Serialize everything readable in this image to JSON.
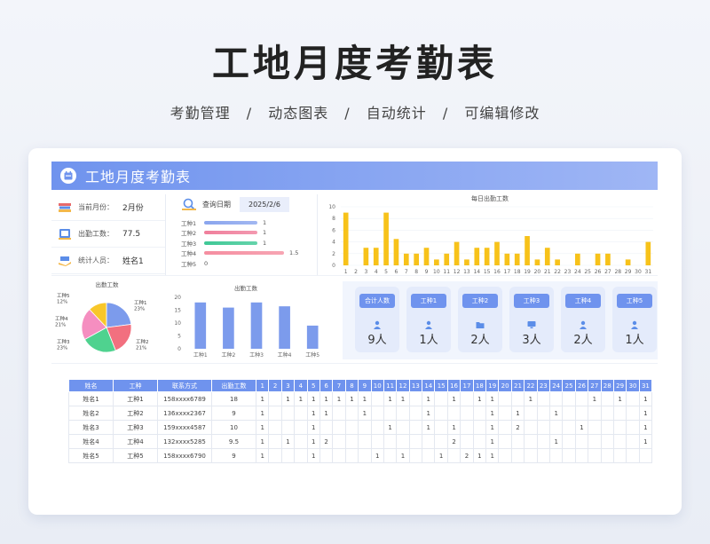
{
  "hero": {
    "title": "工地月度考勤表",
    "features": [
      "考勤管理",
      "动态图表",
      "自动统计",
      "可编辑修改"
    ],
    "separators": [
      "/",
      "/",
      "/"
    ]
  },
  "banner": {
    "title": "工地月度考勤表",
    "icon": "calendar-icon"
  },
  "info": [
    {
      "label": "当前月份：",
      "value": "2月份",
      "icon": "books-icon"
    },
    {
      "label": "出勤工数：",
      "value": "77.5",
      "icon": "board-icon"
    },
    {
      "label": "统计人员：",
      "value": "姓名1",
      "icon": "hand-book-icon"
    }
  ],
  "query": {
    "label": "查询日期",
    "date": "2025/2/6",
    "icon": "magnifier-icon",
    "rows": [
      {
        "name": "工种1",
        "value": 1,
        "label": "1",
        "color": "#8aa5ee"
      },
      {
        "name": "工种2",
        "value": 1,
        "label": "1",
        "color": "#f07f9c"
      },
      {
        "name": "工种3",
        "value": 1,
        "label": "1",
        "color": "#3fc896"
      },
      {
        "name": "工种4",
        "value": 1.5,
        "label": "1.5",
        "color": "#f58ea0"
      },
      {
        "name": "工种5",
        "value": 0,
        "label": "0",
        "color": "#8aa5ee"
      }
    ]
  },
  "chart_data": [
    {
      "type": "bar",
      "title": "每日出勤工数",
      "categories": [
        "1",
        "2",
        "3",
        "4",
        "5",
        "6",
        "7",
        "8",
        "9",
        "10",
        "11",
        "12",
        "13",
        "14",
        "15",
        "16",
        "17",
        "18",
        "19",
        "20",
        "21",
        "22",
        "23",
        "24",
        "25",
        "26",
        "27",
        "28",
        "29",
        "30",
        "31"
      ],
      "values": [
        9,
        0,
        3,
        3,
        9,
        4.5,
        2,
        2,
        3,
        1,
        2,
        4,
        1,
        3,
        3,
        4,
        2,
        2,
        5,
        1,
        3,
        1,
        0,
        2,
        0,
        2,
        2,
        0,
        1,
        0,
        4
      ],
      "ylim": [
        0,
        10
      ],
      "yticks": [
        0,
        2,
        4,
        6,
        8,
        10
      ],
      "color": "#f7c21a"
    },
    {
      "type": "pie",
      "title": "出勤工数",
      "slices": [
        {
          "name": "工种1",
          "pct": "23%",
          "value": 23,
          "color": "#7c9bec"
        },
        {
          "name": "工种2",
          "pct": "21%",
          "value": 21,
          "color": "#f2707f"
        },
        {
          "name": "工种3",
          "pct": "23%",
          "value": 23,
          "color": "#4fd28f"
        },
        {
          "name": "工种4",
          "pct": "21%",
          "value": 21,
          "color": "#f58ec0"
        },
        {
          "name": "工种5",
          "pct": "12%",
          "value": 12,
          "color": "#f8c72a"
        }
      ]
    },
    {
      "type": "bar",
      "title": "出勤工数",
      "categories": [
        "工种1",
        "工种2",
        "工种3",
        "工种4",
        "工种5"
      ],
      "values": [
        18,
        16,
        18,
        16.5,
        9
      ],
      "ylim": [
        0,
        20
      ],
      "yticks": [
        0,
        5,
        10,
        15,
        20
      ],
      "color": "#7c9bec"
    }
  ],
  "tiles": [
    {
      "label": "合计人数",
      "value": "9人",
      "icon": "person-icon"
    },
    {
      "label": "工种1",
      "value": "1人",
      "icon": "person-icon"
    },
    {
      "label": "工种2",
      "value": "2人",
      "icon": "folder-icon"
    },
    {
      "label": "工种3",
      "value": "3人",
      "icon": "monitor-icon"
    },
    {
      "label": "工种4",
      "value": "2人",
      "icon": "person-icon"
    },
    {
      "label": "工种5",
      "value": "1人",
      "icon": "person-icon"
    }
  ],
  "table": {
    "headers": [
      "姓名",
      "工种",
      "联系方式",
      "出勤工数",
      "1",
      "2",
      "3",
      "4",
      "5",
      "6",
      "7",
      "8",
      "9",
      "10",
      "11",
      "12",
      "13",
      "14",
      "15",
      "16",
      "17",
      "18",
      "19",
      "20",
      "21",
      "22",
      "23",
      "24",
      "25",
      "26",
      "27",
      "28",
      "29",
      "30",
      "31"
    ],
    "rows": [
      [
        "姓名1",
        "工种1",
        "158xxxx6789",
        "18",
        "1",
        "",
        "1",
        "1",
        "1",
        "1",
        "1",
        "1",
        "1",
        "",
        "1",
        "1",
        "",
        "1",
        "",
        "1",
        "",
        "1",
        "1",
        "",
        "",
        "1",
        "",
        "",
        "",
        "",
        "1",
        "",
        "1",
        "",
        "1"
      ],
      [
        "姓名2",
        "工种2",
        "136xxxx2367",
        "9",
        "1",
        "",
        "",
        "",
        "1",
        "1",
        "",
        "",
        "1",
        "",
        "",
        "",
        "",
        "1",
        "",
        "",
        "",
        "",
        "1",
        "",
        "1",
        "",
        "",
        "1",
        "",
        "",
        "",
        "",
        "",
        "",
        "1"
      ],
      [
        "姓名3",
        "工种3",
        "159xxxx4587",
        "10",
        "1",
        "",
        "",
        "",
        "1",
        "",
        "",
        "",
        "",
        "",
        "1",
        "",
        "",
        "1",
        "",
        "1",
        "",
        "",
        "1",
        "",
        "2",
        "",
        "",
        "",
        "",
        "1",
        "",
        "",
        "",
        "",
        "1"
      ],
      [
        "姓名4",
        "工种4",
        "132xxxx5285",
        "9.5",
        "1",
        "",
        "1",
        "",
        "1",
        "2",
        "",
        "",
        "",
        "",
        "",
        "",
        "",
        "",
        "",
        "2",
        "",
        "",
        "1",
        "",
        "",
        "",
        "",
        "1",
        "",
        "",
        "",
        "",
        "",
        "",
        "1"
      ],
      [
        "姓名5",
        "工种5",
        "158xxxx6790",
        "9",
        "1",
        "",
        "",
        "",
        "1",
        "",
        "",
        "",
        "",
        "1",
        "",
        "1",
        "",
        "",
        "1",
        "",
        "2",
        "1",
        "1",
        "",
        "",
        "",
        "",
        "",
        "",
        "",
        "",
        "",
        "",
        "",
        ""
      ]
    ]
  }
}
